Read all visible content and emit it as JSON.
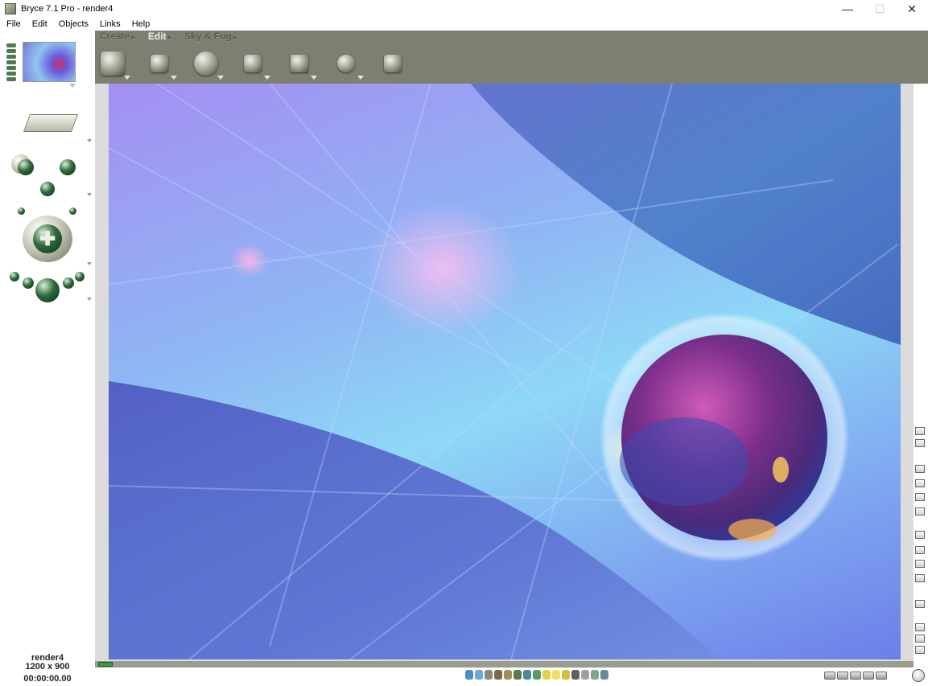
{
  "window": {
    "title": "Bryce 7.1  Pro - render4",
    "minimize": "—",
    "maximize": "☐",
    "close": "✕"
  },
  "menu": [
    "File",
    "Edit",
    "Objects",
    "Links",
    "Help"
  ],
  "palette_tabs": [
    {
      "label": "Create",
      "active": false
    },
    {
      "label": "Edit",
      "active": true
    },
    {
      "label": "Sky & Fog",
      "active": false
    }
  ],
  "edit_tools": [
    {
      "icon": "material-lab-icon"
    },
    {
      "icon": "resize-icon"
    },
    {
      "icon": "rotate-icon"
    },
    {
      "icon": "reposition-icon"
    },
    {
      "icon": "align-icon"
    },
    {
      "icon": "randomize-icon"
    },
    {
      "icon": "terrain-editor-icon"
    }
  ],
  "document": {
    "name": "render4",
    "size": "1200 x 900",
    "time": "00:00:00.00"
  },
  "colors": {
    "toolbar_bg": "#7d7f72",
    "active_tab": "#e8e8e0",
    "inactive_tab": "#5a5c50",
    "timeline_bg": "#9a9c90"
  }
}
